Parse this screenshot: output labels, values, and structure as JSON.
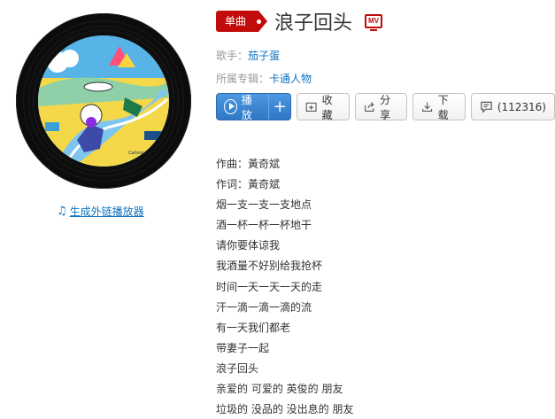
{
  "song": {
    "badge": "单曲",
    "title": "浪子回头",
    "mv_label": "MV",
    "singer_label": "歌手：",
    "singer": "茄子蛋",
    "album_label": "所属专辑：",
    "album": "卡通人物"
  },
  "cover": {
    "subtitle_text": "Cartoon Wor"
  },
  "external_link": "生成外链播放器",
  "buttons": {
    "play": "播放",
    "add": "+",
    "collect": "收藏",
    "share": "分享",
    "download": "下载",
    "comment": "(112316)"
  },
  "lyrics": [
    "作曲：黃奇斌",
    "作词：黃奇斌",
    "烟一支一支一支地点",
    "酒一杯一杯一杯地干",
    "请你要体谅我",
    "我酒量不好别给我抢杯",
    "时间一天一天一天的走",
    "汗一滴一滴一滴的流",
    "有一天我们都老",
    "带妻子一起",
    "浪子回头",
    "亲爱的 可爱的 英俊的 朋友",
    "垃圾的 没品的 没出息的 朋友"
  ],
  "colors": {
    "accent_red": "#c20c0c",
    "link_blue": "#0c73c2",
    "play_blue": "#3a87d4"
  }
}
